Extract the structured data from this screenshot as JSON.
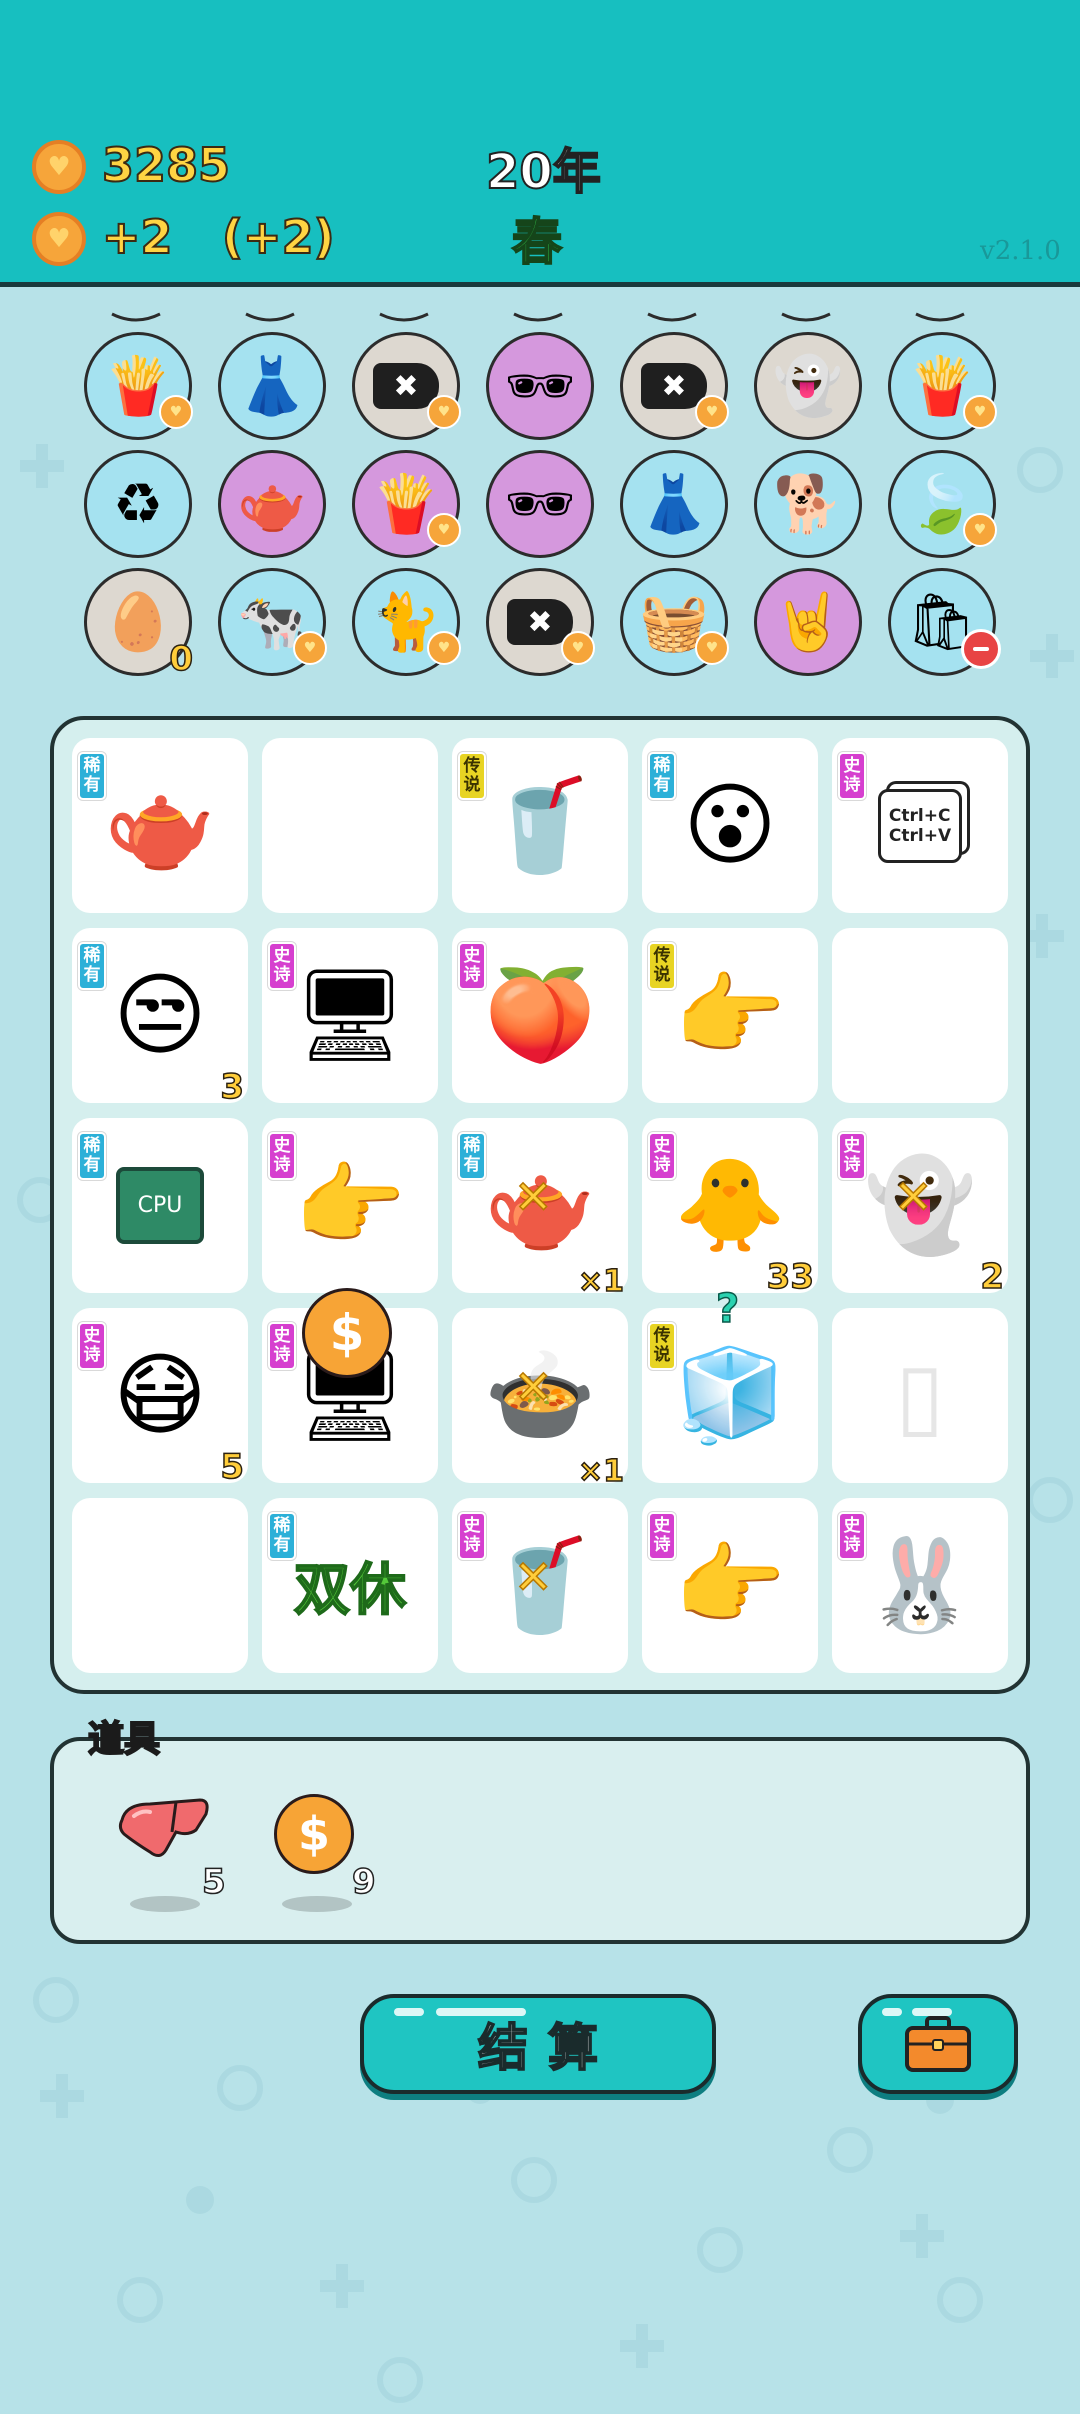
{
  "header": {
    "coins": "3285",
    "income": "+2",
    "income_bonus": "(+2)",
    "year": "20年",
    "season": "春",
    "version": "v2.1.0"
  },
  "owned_items": [
    {
      "icon": "fries-icon",
      "glyph": "🍟",
      "bg": "blue",
      "badge": "heart"
    },
    {
      "icon": "skirt-icon",
      "glyph": "👗",
      "bg": "blue"
    },
    {
      "icon": "delete-tag-icon",
      "glyph": "✖",
      "bg": "grey",
      "badge": "heart"
    },
    {
      "icon": "eyepatch-icon",
      "glyph": "🕶",
      "bg": "purple"
    },
    {
      "icon": "delete-tag-icon",
      "glyph": "✖",
      "bg": "grey",
      "badge": "heart"
    },
    {
      "icon": "ghost-icon",
      "glyph": "👻",
      "bg": "grey"
    },
    {
      "icon": "fries-icon",
      "glyph": "🍟",
      "bg": "blue",
      "badge": "heart"
    },
    {
      "icon": "trash-bag-icon",
      "glyph": "♻",
      "bg": "blue"
    },
    {
      "icon": "gravy-boat-icon",
      "glyph": "🫖",
      "bg": "purple"
    },
    {
      "icon": "fries-icon",
      "glyph": "🍟",
      "bg": "purple",
      "badge": "heart"
    },
    {
      "icon": "eyepatch-icon",
      "glyph": "🕶",
      "bg": "purple"
    },
    {
      "icon": "skirt-icon",
      "glyph": "👗",
      "bg": "blue"
    },
    {
      "icon": "dog-icon",
      "glyph": "🐕",
      "bg": "blue"
    },
    {
      "icon": "leaf-icon",
      "glyph": "🍃",
      "bg": "blue",
      "badge": "heart"
    },
    {
      "icon": "egg-tray-icon",
      "glyph": "🥚",
      "bg": "grey",
      "count": "0"
    },
    {
      "icon": "cows-icon",
      "glyph": "🐄",
      "bg": "blue",
      "badge": "heart"
    },
    {
      "icon": "cat-icon",
      "glyph": "🐈",
      "bg": "blue",
      "badge": "heart"
    },
    {
      "icon": "delete-tag-icon",
      "glyph": "✖",
      "bg": "grey",
      "badge": "heart"
    },
    {
      "icon": "fruit-basket-icon",
      "glyph": "🧺",
      "bg": "blue",
      "badge": "heart"
    },
    {
      "icon": "rock-hand-icon",
      "glyph": "🤘",
      "bg": "purple"
    },
    {
      "icon": "bag-icon",
      "glyph": "🛍",
      "bg": "blue",
      "badge": "minus"
    }
  ],
  "grid": [
    {
      "icon": "teapot-icon",
      "glyph": "🫖",
      "tag": "稀有",
      "tag_type": "rare"
    },
    {
      "icon": "empty-slot",
      "glyph": ""
    },
    {
      "icon": "milk-tea-icon",
      "glyph": "🥤",
      "tag": "传说",
      "tag_type": "legend"
    },
    {
      "icon": "glasses-man-icon",
      "glyph": "😮",
      "tag": "稀有",
      "tag_type": "rare"
    },
    {
      "icon": "copy-paste-icon",
      "glyph": "Ctrl+C\nCtrl+V",
      "tag": "史诗",
      "tag_type": "epic"
    },
    {
      "icon": "hat-man-icon",
      "glyph": "😒",
      "tag": "稀有",
      "tag_type": "rare",
      "count": "3"
    },
    {
      "icon": "gpu-icon",
      "glyph": "🖥",
      "tag": "史诗",
      "tag_type": "epic"
    },
    {
      "icon": "peach-icon",
      "glyph": "🍑",
      "tag": "史诗",
      "tag_type": "epic"
    },
    {
      "icon": "pointing-hand-icon",
      "glyph": "👉",
      "tag": "传说",
      "tag_type": "legend"
    },
    {
      "icon": "empty-slot",
      "glyph": ""
    },
    {
      "icon": "cpu-icon",
      "glyph": "CPU",
      "tag": "稀有",
      "tag_type": "rare"
    },
    {
      "icon": "pointing-hand-icon",
      "glyph": "👉",
      "tag": "史诗",
      "tag_type": "epic"
    },
    {
      "icon": "teapot-icon",
      "glyph": "🫖",
      "tag": "稀有",
      "tag_type": "rare",
      "mult": "×1",
      "cross": true
    },
    {
      "icon": "duck-icon",
      "glyph": "🐥",
      "tag": "史诗",
      "tag_type": "epic",
      "count": "33"
    },
    {
      "icon": "ghost-icon",
      "glyph": "👻",
      "tag": "史诗",
      "tag_type": "epic",
      "count": "2",
      "cross": true
    },
    {
      "icon": "masked-man-icon",
      "glyph": "😷",
      "tag": "史诗",
      "tag_type": "epic",
      "count": "5"
    },
    {
      "icon": "gpu-icon",
      "glyph": "🖥",
      "tag": "史诗",
      "tag_type": "epic",
      "coin": true
    },
    {
      "icon": "soup-bowl-icon",
      "glyph": "🍲",
      "mult": "×1",
      "cross": true
    },
    {
      "icon": "fridge-icon",
      "glyph": "🧊",
      "tag": "传说",
      "tag_type": "legend",
      "question": "?"
    },
    {
      "icon": "faded-fridge-icon",
      "glyph": "▯"
    },
    {
      "icon": "empty-slot",
      "glyph": ""
    },
    {
      "icon": "weekend-text-icon",
      "glyph": "双休",
      "tag": "稀有",
      "tag_type": "rare"
    },
    {
      "icon": "milk-tea-icon",
      "glyph": "🥤",
      "tag": "史诗",
      "tag_type": "epic",
      "cross": true
    },
    {
      "icon": "pointing-hand-icon",
      "glyph": "👉",
      "tag": "史诗",
      "tag_type": "epic"
    },
    {
      "icon": "rabbit-house-icon",
      "glyph": "🐰",
      "tag": "史诗",
      "tag_type": "epic"
    }
  ],
  "items_panel": {
    "title": "道具",
    "items": [
      {
        "icon": "liver-icon",
        "glyph": "🫀",
        "count": "5"
      },
      {
        "icon": "coin-icon",
        "glyph": "$",
        "count": "9"
      }
    ]
  },
  "buttons": {
    "settle": "结算",
    "backpack": "backpack-icon"
  }
}
